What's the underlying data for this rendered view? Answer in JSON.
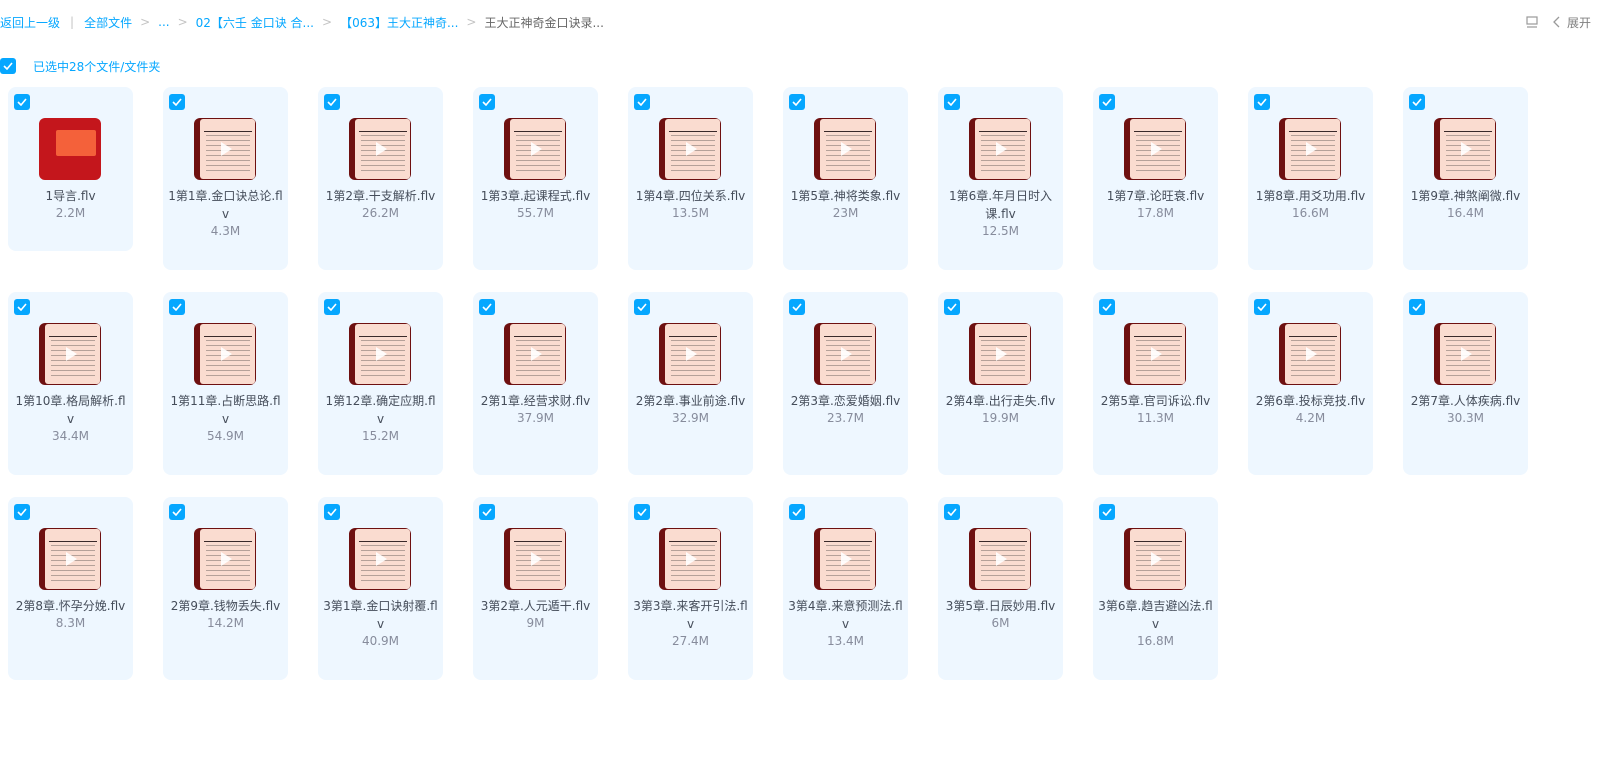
{
  "breadcrumb": {
    "back": "返回上一级",
    "all_files": "全部文件",
    "ellipsis": "...",
    "crumb_1": "02【六壬 金口诀 合...",
    "crumb_2": "【063】王大正神奇...",
    "current": "王大正神奇金口诀录..."
  },
  "toolbar": {
    "expand_label": "展开",
    "icons": [
      "list-view-icon",
      "chevron-left-icon"
    ]
  },
  "selection": {
    "summary": "已选中28个文件/文件夹"
  },
  "colors": {
    "accent": "#06a7ff",
    "card_bg": "#eef7ff",
    "thumb_border": "#6e1010",
    "thumb_slide": "#fadcd0"
  },
  "files": [
    {
      "name": "1导言.flv",
      "size": "2.2M",
      "thumb": "cover"
    },
    {
      "name": "1第1章.金口诀总论.flv",
      "size": "4.3M",
      "thumb": "slide"
    },
    {
      "name": "1第2章.干支解析.flv",
      "size": "26.2M",
      "thumb": "slide"
    },
    {
      "name": "1第3章.起课程式.flv",
      "size": "55.7M",
      "thumb": "slide"
    },
    {
      "name": "1第4章.四位关系.flv",
      "size": "13.5M",
      "thumb": "slide"
    },
    {
      "name": "1第5章.神将类象.flv",
      "size": "23M",
      "thumb": "slide"
    },
    {
      "name": "1第6章.年月日时入课.flv",
      "size": "12.5M",
      "thumb": "slide"
    },
    {
      "name": "1第7章.论旺衰.flv",
      "size": "17.8M",
      "thumb": "slide"
    },
    {
      "name": "1第8章.用爻功用.flv",
      "size": "16.6M",
      "thumb": "slide"
    },
    {
      "name": "1第9章.神煞阐微.flv",
      "size": "16.4M",
      "thumb": "slide"
    },
    {
      "name": "1第10章.格局解析.flv",
      "size": "34.4M",
      "thumb": "slide"
    },
    {
      "name": "1第11章.占断思路.flv",
      "size": "54.9M",
      "thumb": "slide"
    },
    {
      "name": "1第12章.确定应期.flv",
      "size": "15.2M",
      "thumb": "slide"
    },
    {
      "name": "2第1章.经营求财.flv",
      "size": "37.9M",
      "thumb": "slide"
    },
    {
      "name": "2第2章.事业前途.flv",
      "size": "32.9M",
      "thumb": "slide"
    },
    {
      "name": "2第3章.恋爱婚姻.flv",
      "size": "23.7M",
      "thumb": "slide"
    },
    {
      "name": "2第4章.出行走失.flv",
      "size": "19.9M",
      "thumb": "slide"
    },
    {
      "name": "2第5章.官司诉讼.flv",
      "size": "11.3M",
      "thumb": "slide"
    },
    {
      "name": "2第6章.投标竞技.flv",
      "size": "4.2M",
      "thumb": "slide"
    },
    {
      "name": "2第7章.人体疾病.flv",
      "size": "30.3M",
      "thumb": "slide"
    },
    {
      "name": "2第8章.怀孕分娩.flv",
      "size": "8.3M",
      "thumb": "slide"
    },
    {
      "name": "2第9章.钱物丢失.flv",
      "size": "14.2M",
      "thumb": "slide"
    },
    {
      "name": "3第1章.金口诀射覆.flv",
      "size": "40.9M",
      "thumb": "slide"
    },
    {
      "name": "3第2章.人元遁干.flv",
      "size": "9M",
      "thumb": "slide"
    },
    {
      "name": "3第3章.来客开引法.flv",
      "size": "27.4M",
      "thumb": "slide"
    },
    {
      "name": "3第4章.来意预测法.flv",
      "size": "13.4M",
      "thumb": "slide"
    },
    {
      "name": "3第5章.日辰妙用.flv",
      "size": "6M",
      "thumb": "slide"
    },
    {
      "name": "3第6章.趋吉避凶法.flv",
      "size": "16.8M",
      "thumb": "slide"
    }
  ]
}
